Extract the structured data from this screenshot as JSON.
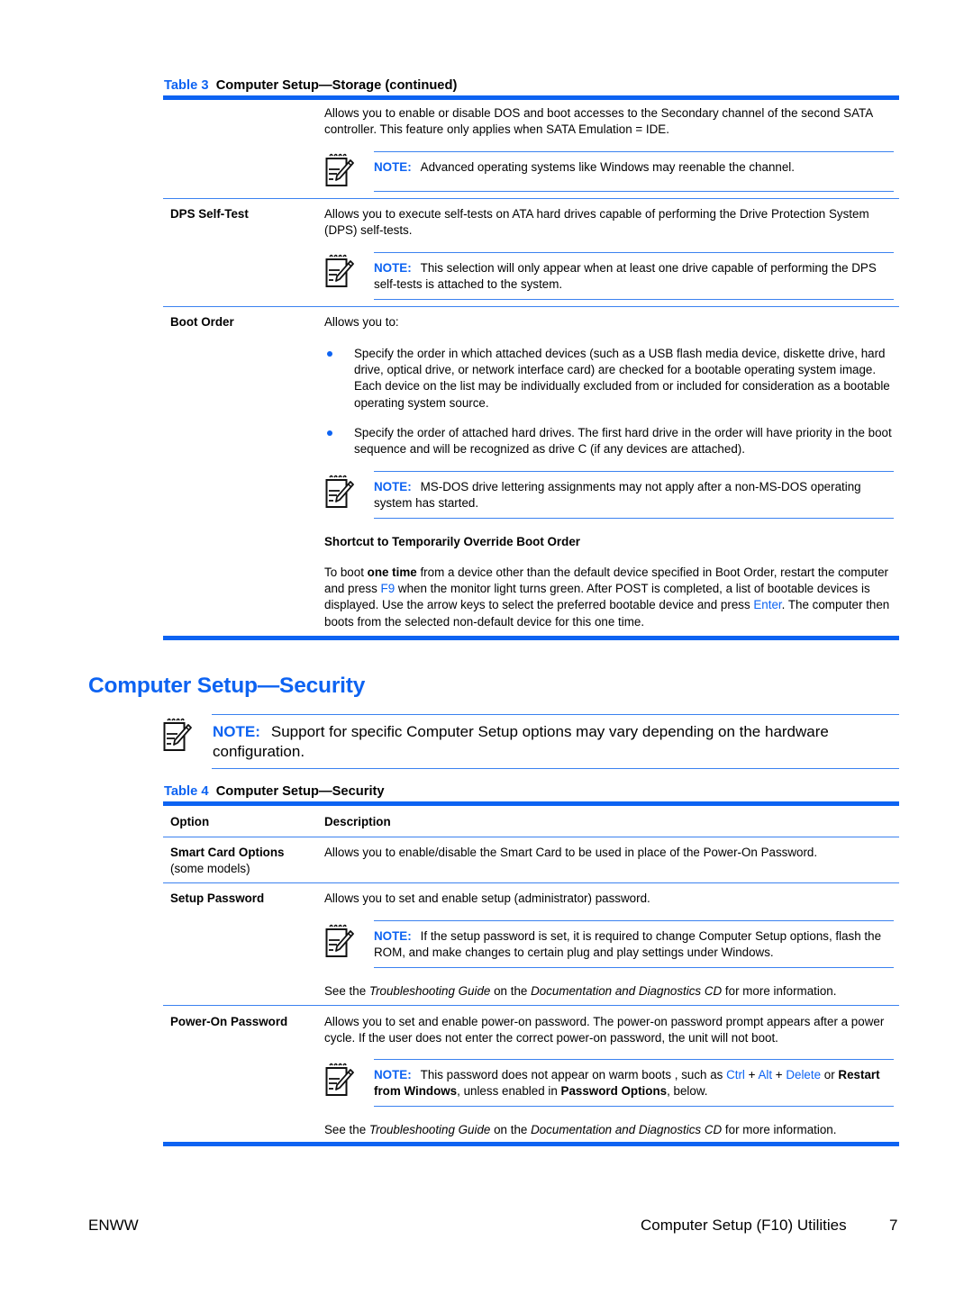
{
  "table3": {
    "number": "Table 3",
    "title": "Computer Setup—Storage (continued)",
    "rows": [
      {
        "option": "",
        "description": "Allows you to enable or disable DOS and boot accesses to the Secondary channel of the second SATA controller. This feature only applies when SATA Emulation = IDE.",
        "note": "Advanced operating systems like Windows may reenable the channel."
      },
      {
        "option": "DPS Self-Test",
        "description": "Allows you to execute self-tests on ATA hard drives capable of performing the Drive Protection System (DPS) self-tests.",
        "note": "This selection will only appear when at least one drive capable of performing the DPS self-tests is attached to the system."
      },
      {
        "option": "Boot Order",
        "description": "Allows you to:",
        "bullets": [
          "Specify the order in which attached devices (such as a USB flash media device, diskette drive, hard drive, optical drive, or network interface card) are checked for a bootable operating system image. Each device on the list may be individually excluded from or included for consideration as a bootable operating system source.",
          "Specify the order of attached hard drives. The first hard drive in the order will have priority in the boot sequence and will be recognized as drive C (if any devices are attached)."
        ],
        "note": "MS-DOS drive lettering assignments may not apply after a non-MS-DOS operating system has started.",
        "subheading": "Shortcut to Temporarily Override Boot Order",
        "shortcut": {
          "p1": "To boot ",
          "bold1": "one time",
          "p2": " from a device other than the default device specified in Boot Order, restart the computer and press ",
          "key1": "F9",
          "p3": " when the monitor light turns green. After POST is completed, a list of bootable devices is displayed. Use the arrow keys to select the preferred bootable device and press ",
          "key2": "Enter",
          "p4": ". The computer then boots from the selected non-default device for this one time."
        }
      }
    ]
  },
  "section": {
    "heading": "Computer Setup—Security",
    "note_label": "NOTE:",
    "note": "Support for specific Computer Setup options may vary depending on the hardware configuration."
  },
  "table4": {
    "number": "Table 4",
    "title": "Computer Setup—Security",
    "headers": {
      "option": "Option",
      "description": "Description"
    },
    "rows": [
      {
        "option": "Smart Card Options",
        "option_sub": "(some models)",
        "description": "Allows you to enable/disable the Smart Card to be used in place of the Power-On Password."
      },
      {
        "option": "Setup Password",
        "description": "Allows you to set and enable setup (administrator) password.",
        "note": "If the setup password is set, it is required to change Computer Setup options, flash the ROM, and make changes to certain plug and play settings under Windows.",
        "see": {
          "p1": "See the ",
          "guide": "Troubleshooting Guide",
          "p2": " on the ",
          "cd": "Documentation and Diagnostics CD",
          "p3": " for more information."
        }
      },
      {
        "option": "Power-On Password",
        "description": "Allows you to set and enable power-on password. The power-on password prompt appears after a power cycle. If the user does not enter the correct power-on password, the unit will not boot.",
        "note": {
          "p1": "This password does not appear on warm boots , such as ",
          "k1": "Ctrl",
          "plus1": " + ",
          "k2": "Alt",
          "plus2": " + ",
          "k3": "Delete",
          "p2": " or ",
          "b1": "Restart from Windows",
          "p3": ", unless enabled in ",
          "b2": "Password Options",
          "p4": ", below."
        },
        "see": {
          "p1": "See the ",
          "guide": "Troubleshooting Guide",
          "p2": " on the ",
          "cd": "Documentation and Diagnostics CD",
          "p3": " for more information."
        }
      }
    ]
  },
  "note_label": "NOTE:",
  "icon": "note-pencil-icon",
  "accent_color": "#0d63f2",
  "footer": {
    "left": "ENWW",
    "title": "Computer Setup (F10) Utilities",
    "page": "7"
  }
}
